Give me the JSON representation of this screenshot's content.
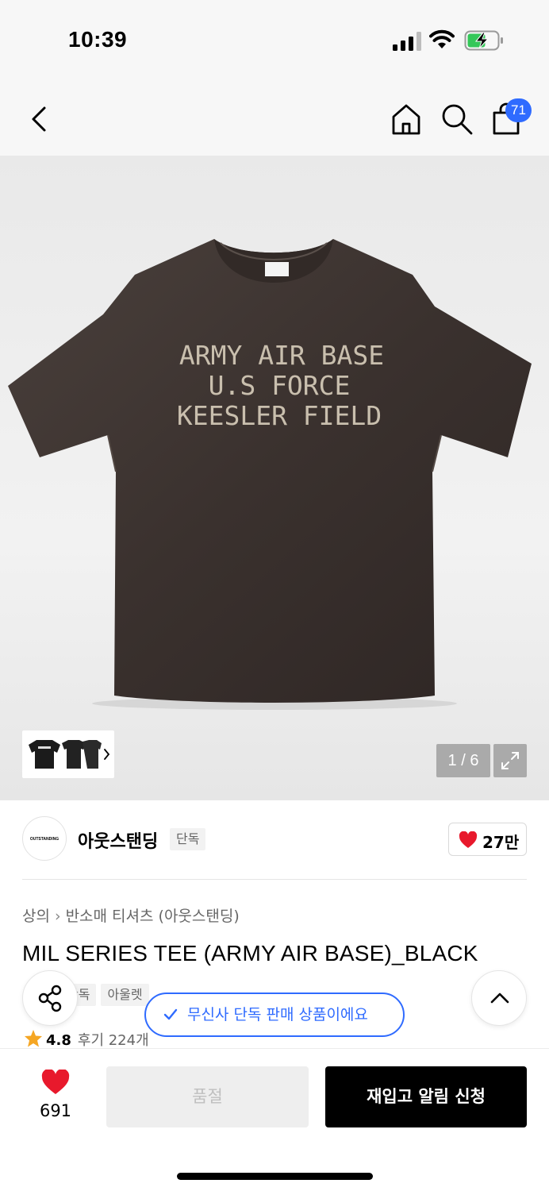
{
  "status_bar": {
    "time": "10:39"
  },
  "nav": {
    "cart_count": "71"
  },
  "gallery": {
    "shirt_print_lines": [
      "ARMY AIR BASE",
      "U.S FORCE",
      "KEESLER FIELD"
    ],
    "page_counter": "1 / 6"
  },
  "brand": {
    "logo_text": "OUTSTANDING",
    "name": "아웃스탠딩",
    "tag": "단독",
    "likes": "27만"
  },
  "breadcrumb": [
    "상의",
    "반소매 티셔츠 (아웃스탠딩)"
  ],
  "product": {
    "title": "MIL SERIES TEE (ARMY AIR BASE)_BLACK",
    "tags": [
      "단독",
      "아울렛"
    ],
    "rating": "4.8",
    "review_label": "후기 224개"
  },
  "toast": {
    "text": "무신사 단독 판매 상품이에요"
  },
  "bottom_bar": {
    "wish_count": "691",
    "soldout_label": "품절",
    "restock_label": "재입고 알림 신청"
  },
  "colors": {
    "accent": "#2f6bff",
    "heart": "#e8192c",
    "star": "#f5a623"
  }
}
